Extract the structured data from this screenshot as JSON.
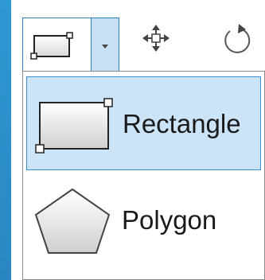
{
  "toolbar": {
    "shape_split_button": {
      "current_icon": "rectangle-shape-icon",
      "dropdown_icon": "chevron-down-icon"
    },
    "tools": [
      {
        "name": "move-icon"
      },
      {
        "name": "rotate-icon"
      }
    ]
  },
  "menu": {
    "items": [
      {
        "label": "Rectangle",
        "icon": "rectangle-shape-icon",
        "selected": true
      },
      {
        "label": "Polygon",
        "icon": "pentagon-shape-icon",
        "selected": false
      }
    ]
  },
  "colors": {
    "selection_background": "#cce4f7",
    "selection_border": "#3b8fd4",
    "accent": "#2f7fc0",
    "window_edge": "#2d95cf"
  }
}
